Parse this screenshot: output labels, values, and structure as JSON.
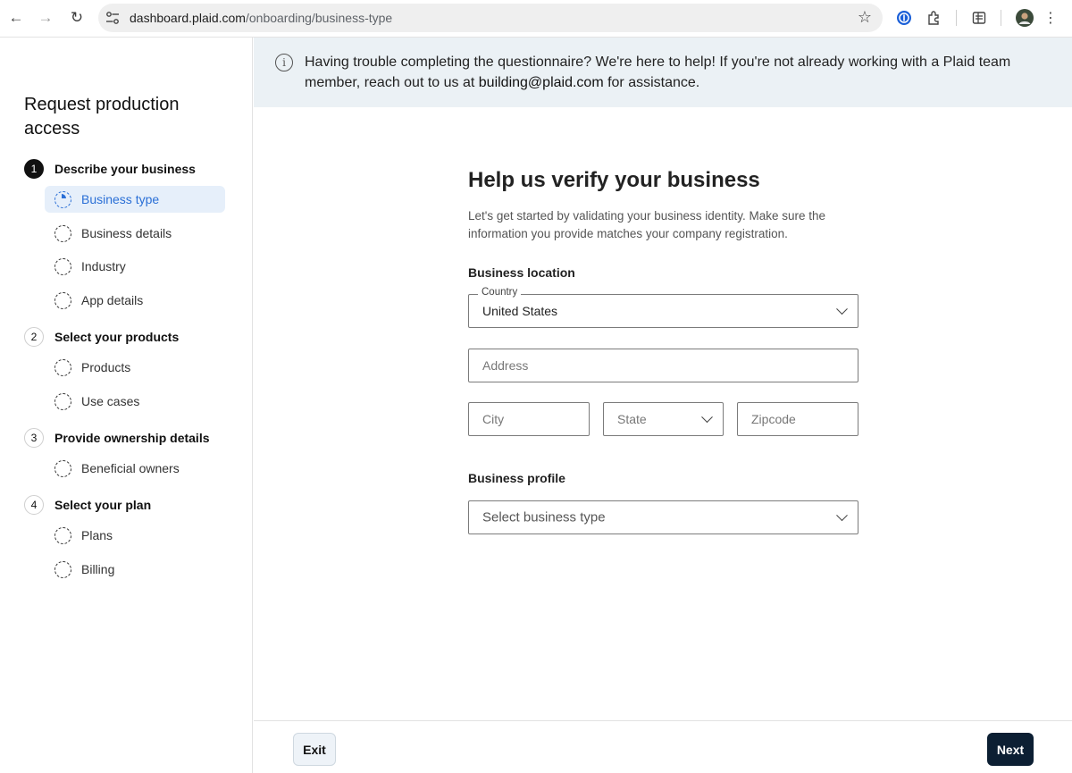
{
  "browser": {
    "url_host": "dashboard.plaid.com",
    "url_path": "/onboarding/business-type"
  },
  "banner": {
    "message_before": "Having trouble completing the questionnaire? We're here to help! If you're not already working with a Plaid team member, reach out to us at ",
    "email": "building@plaid.com",
    "message_after": " for assistance."
  },
  "sidebar": {
    "title": "Request production access",
    "steps": [
      {
        "number": "1",
        "label": "Describe your business",
        "items": [
          "Business type",
          "Business details",
          "Industry",
          "App details"
        ]
      },
      {
        "number": "2",
        "label": "Select your products",
        "items": [
          "Products",
          "Use cases"
        ]
      },
      {
        "number": "3",
        "label": "Provide ownership details",
        "items": [
          "Beneficial owners"
        ]
      },
      {
        "number": "4",
        "label": "Select your plan",
        "items": [
          "Plans",
          "Billing"
        ]
      }
    ]
  },
  "form": {
    "title": "Help us verify your business",
    "description": "Let's get started by validating your business identity. Make sure the information you provide matches your company registration.",
    "location_label": "Business location",
    "country_legend": "Country",
    "country_value": "United States",
    "address_placeholder": "Address",
    "city_placeholder": "City",
    "state_placeholder": "State",
    "zip_placeholder": "Zipcode",
    "profile_label": "Business profile",
    "business_type_placeholder": "Select business type"
  },
  "footer": {
    "exit_label": "Exit",
    "next_label": "Next"
  }
}
